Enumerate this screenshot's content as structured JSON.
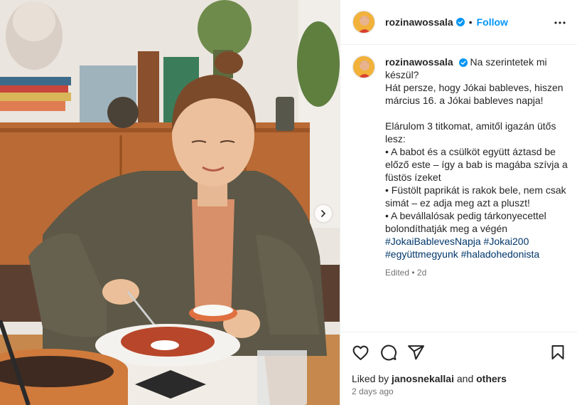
{
  "header": {
    "username": "rozinawossala",
    "separator": "•",
    "follow_label": "Follow"
  },
  "caption": {
    "username": "rozinawossala",
    "lines": [
      "Na szerintetek mi készül?",
      "Hát persze, hogy Jókai bableves, hiszen március 16. a Jókai bableves napja!",
      "",
      "Elárulom 3 titkomat, amitől igazán ütős lesz:",
      "• A babot és a csülköt együtt áztasd be előző este – így a bab is magába szívja a füstös ízeket",
      "• Füstölt paprikát is rakok bele, nem csak simát – ez adja meg azt a pluszt!",
      "• A bevállalósak pedig tárkonyecettel bolondíthatják meg a végén"
    ],
    "hashtags": [
      "#JokaiBablevesNapja",
      "#Jokai200",
      "#együttmegyunk",
      "#haladohedonista"
    ],
    "edited": "Edited",
    "edited_sep": "•",
    "edited_age": "2d"
  },
  "footer": {
    "liked_prefix": "Liked by",
    "liked_user": "janosnekallai",
    "liked_and": "and",
    "liked_others": "others",
    "age": "2 days ago"
  },
  "icons": {
    "like": "heart-icon",
    "comment": "comment-icon",
    "share": "share-icon",
    "save": "bookmark-icon",
    "more": "more-icon",
    "next": "chevron-right-icon",
    "verified": "verified-badge-icon"
  },
  "colors": {
    "link": "#0095f6",
    "hashtag": "#00376b",
    "muted": "#737373",
    "verified": "#0095f6"
  }
}
